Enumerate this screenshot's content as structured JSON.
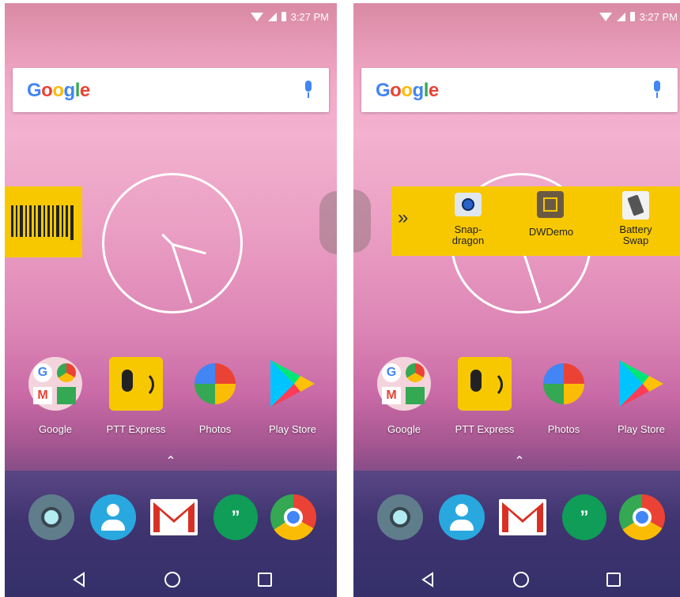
{
  "status": {
    "time": "3:27 PM"
  },
  "search": {
    "logo_text": "Google"
  },
  "apps": [
    {
      "label": "Google"
    },
    {
      "label": "PTT Express"
    },
    {
      "label": "Photos"
    },
    {
      "label": "Play Store"
    }
  ],
  "overlay_apps": [
    {
      "label": "Snap-\ndragon"
    },
    {
      "label": "DWDemo"
    },
    {
      "label": "Battery\nSwap"
    }
  ],
  "icons": {
    "dock": [
      "settings-icon",
      "contacts-icon",
      "gmail-icon",
      "hangouts-icon",
      "chrome-icon"
    ],
    "nav": [
      "back-icon",
      "home-icon",
      "recents-icon"
    ]
  },
  "colors": {
    "overlay_yellow": "#f7c800"
  }
}
